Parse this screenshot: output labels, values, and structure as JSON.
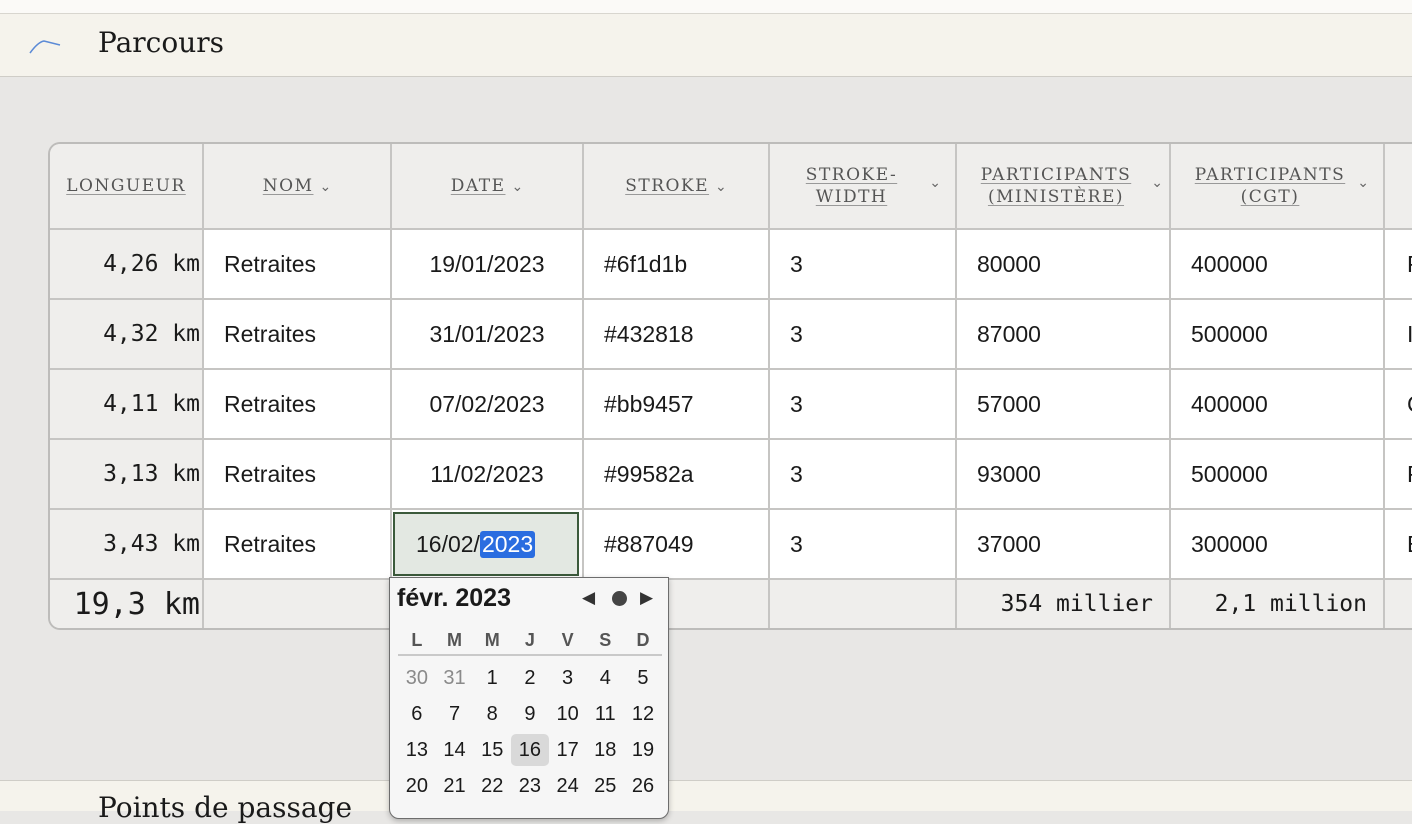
{
  "header": {
    "title": "Parcours",
    "icon": "line-chart-icon"
  },
  "table": {
    "columns": [
      {
        "key": "longueur",
        "label": "LONGUEUR"
      },
      {
        "key": "nom",
        "label": "NOM",
        "sortable": true
      },
      {
        "key": "date",
        "label": "DATE",
        "sortable": true
      },
      {
        "key": "stroke",
        "label": "STROKE",
        "sortable": true
      },
      {
        "key": "stroke_width",
        "label": "STROKE-\nWIDTH",
        "sortable": true
      },
      {
        "key": "participants_ministere",
        "label": "PARTICIPANTS\n(MINISTÈRE)",
        "sortable": true
      },
      {
        "key": "participants_cgt",
        "label": "PARTICIPANTS\n(CGT)",
        "sortable": true
      }
    ],
    "rows": [
      {
        "longueur": "4,26 km",
        "nom": "Retraites",
        "date": "19/01/2023",
        "stroke": "#6f1d1b",
        "stroke_width": "3",
        "participants_ministere": "80000",
        "participants_cgt": "400000",
        "extra": "P"
      },
      {
        "longueur": "4,32 km",
        "nom": "Retraites",
        "date": "31/01/2023",
        "stroke": "#432818",
        "stroke_width": "3",
        "participants_ministere": "87000",
        "participants_cgt": "500000",
        "extra": "I"
      },
      {
        "longueur": "4,11 km",
        "nom": "Retraites",
        "date": "07/02/2023",
        "stroke": "#bb9457",
        "stroke_width": "3",
        "participants_ministere": "57000",
        "participants_cgt": "400000",
        "extra": "C"
      },
      {
        "longueur": "3,13 km",
        "nom": "Retraites",
        "date": "11/02/2023",
        "stroke": "#99582a",
        "stroke_width": "3",
        "participants_ministere": "93000",
        "participants_cgt": "500000",
        "extra": "P"
      },
      {
        "longueur": "3,43 km",
        "nom": "Retraites",
        "date": "16/02/2023",
        "date_prefix": "16/02/",
        "date_selected": "2023",
        "stroke": "#887049",
        "stroke_width": "3",
        "participants_ministere": "37000",
        "participants_cgt": "300000",
        "extra": "E"
      }
    ],
    "footer": {
      "longueur": "19,3 km",
      "participants_ministere": "354 millier",
      "participants_cgt": "2,1 million"
    }
  },
  "datepicker": {
    "month_label": "févr. 2023",
    "weekdays": [
      "L",
      "M",
      "M",
      "J",
      "V",
      "S",
      "D"
    ],
    "weeks": [
      [
        "30",
        "31",
        "1",
        "2",
        "3",
        "4",
        "5"
      ],
      [
        "6",
        "7",
        "8",
        "9",
        "10",
        "11",
        "12"
      ],
      [
        "13",
        "14",
        "15",
        "16",
        "17",
        "18",
        "19"
      ],
      [
        "20",
        "21",
        "22",
        "23",
        "24",
        "25",
        "26"
      ]
    ],
    "selected_day": "16",
    "muted_days": [
      "30",
      "31"
    ]
  },
  "bottom_panel": {
    "title": "Points de passage"
  },
  "colors": {
    "selection": "#2a6de0",
    "edit_border": "#3b5a3b",
    "header_bg": "#f5f3ec",
    "page_bg": "#e8e7e5"
  }
}
